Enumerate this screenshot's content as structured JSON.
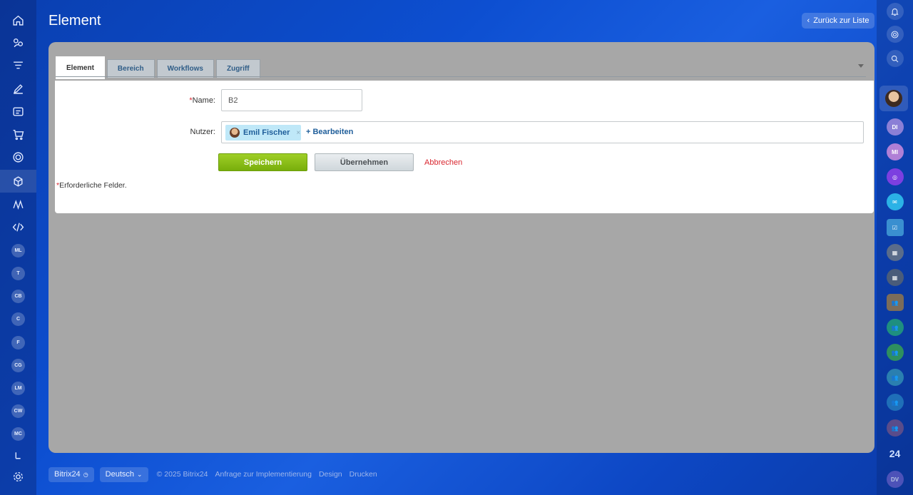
{
  "header": {
    "title": "Element",
    "back_label": "Zurück zur Liste"
  },
  "tabs": [
    {
      "label": "Element",
      "active": true
    },
    {
      "label": "Bereich",
      "active": false
    },
    {
      "label": "Workflows",
      "active": false
    },
    {
      "label": "Zugriff",
      "active": false
    }
  ],
  "form": {
    "required_mark": "*",
    "name_label": "Name:",
    "name_value": "B2",
    "users_label": "Nutzer:",
    "user_chip": {
      "name": "Emil Fischer",
      "remove": "×"
    },
    "edit_link": "+ Bearbeiten",
    "save_label": "Speichern",
    "apply_label": "Übernehmen",
    "cancel_label": "Abbrechen",
    "required_note": "Erforderliche Felder."
  },
  "left_sidebar": {
    "circles": [
      "ML",
      "T",
      "CB",
      "C",
      "F",
      "CG",
      "LM",
      "CW",
      "MC"
    ]
  },
  "right_sidebar": {
    "circles": [
      "DI",
      "MI"
    ],
    "counter": "24",
    "bottom_circle": "DV"
  },
  "footer": {
    "brand": "Bitrix24",
    "language": "Deutsch",
    "copyright": "© 2025 Bitrix24",
    "links": [
      "Anfrage zur Implementierung",
      "Design",
      "Drucken"
    ]
  },
  "colors": {
    "accent_green": "#78ae0b",
    "link_blue": "#1f5e9a",
    "cancel_red": "#d9262f"
  }
}
